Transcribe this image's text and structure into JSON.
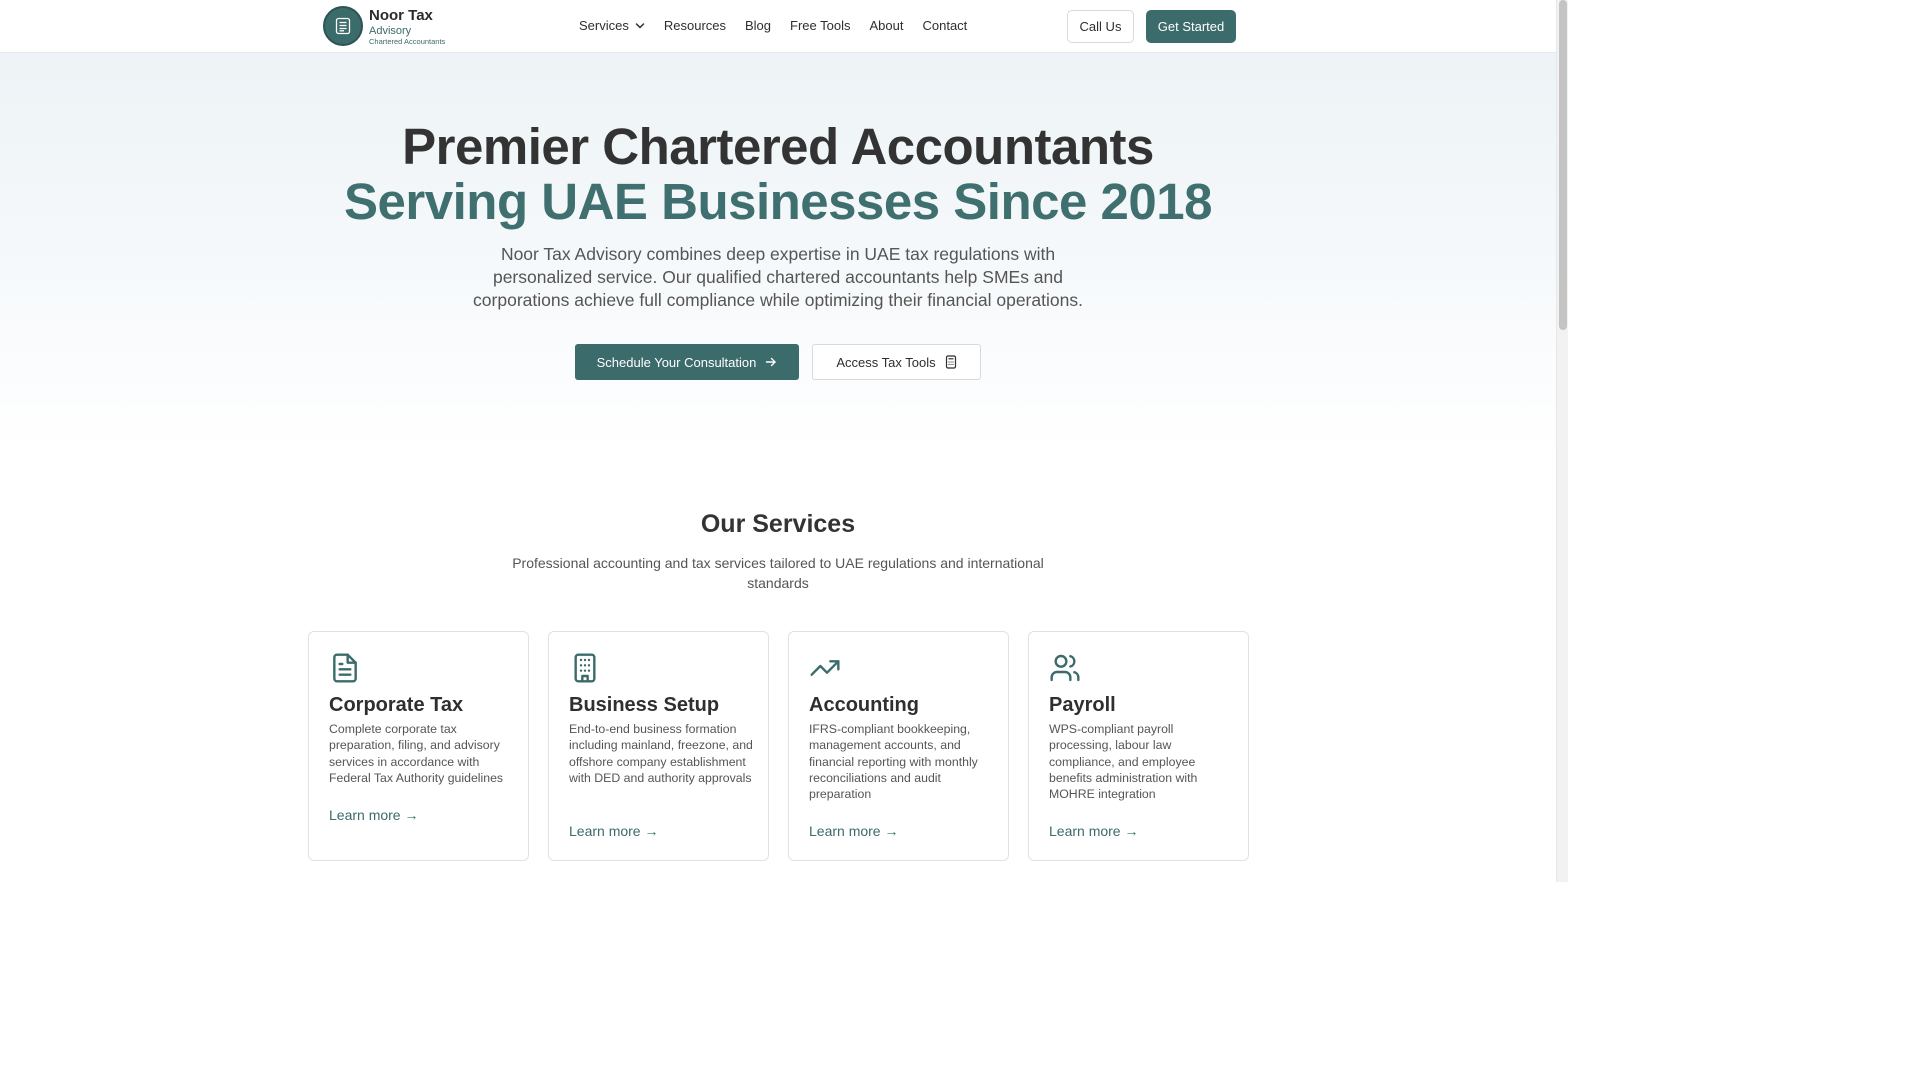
{
  "brand": {
    "name": "Noor Tax",
    "sub": "Advisory",
    "tagline": "Chartered Accountants"
  },
  "nav": {
    "items": [
      {
        "label": "Services"
      },
      {
        "label": "Resources"
      },
      {
        "label": "Blog"
      },
      {
        "label": "Free Tools"
      },
      {
        "label": "About"
      },
      {
        "label": "Contact"
      }
    ],
    "call_label": "Call Us",
    "start_label": "Get Started"
  },
  "hero": {
    "title_line1": "Premier Chartered Accountants",
    "title_line2": "Serving UAE Businesses Since 2018",
    "description": "Noor Tax Advisory combines deep expertise in UAE tax regulations with personalized service. Our qualified chartered accountants help SMEs and corporations achieve full compliance while optimizing their financial operations.",
    "primary_cta": "Schedule Your Consultation",
    "secondary_cta": "Access Tax Tools"
  },
  "services": {
    "title": "Our Services",
    "subtitle": "Professional accounting and tax services tailored to UAE regulations and international standards",
    "cards": [
      {
        "title": "Corporate Tax",
        "icon": "document-icon",
        "description": "Complete corporate tax preparation, filing, and advisory services in accordance with Federal Tax Authority guidelines",
        "link": "Learn more →"
      },
      {
        "title": "Business Setup",
        "icon": "building-icon",
        "description": "End-to-end business formation including mainland, freezone, and offshore company establishment with DED and authority approvals",
        "link": "Learn more →"
      },
      {
        "title": "Accounting",
        "icon": "trending-up-icon",
        "description": "IFRS-compliant bookkeeping, management accounts, and financial reporting with monthly reconciliations and audit preparation",
        "link": "Learn more →"
      },
      {
        "title": "Payroll",
        "icon": "users-icon",
        "description": "WPS-compliant payroll processing, labour law compliance, and employee benefits administration with MOHRE integration",
        "link": "Learn more →"
      }
    ]
  },
  "colors": {
    "accent": "#3b6b6a",
    "heading": "#333333",
    "body_text": "#555555",
    "hero_bg": "#edf3f6"
  }
}
